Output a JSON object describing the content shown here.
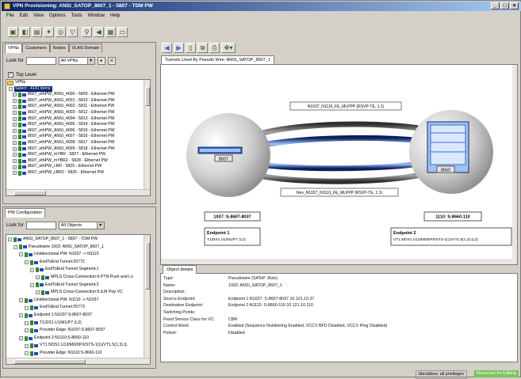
{
  "window": {
    "title": "VPN Provisioning: ANSI_SATOP_8607_1 - 5807 - TDM PW"
  },
  "menu": [
    "File",
    "Edit",
    "View",
    "Options",
    "Tools",
    "Window",
    "Help"
  ],
  "left_top": {
    "tabs": [
      "VPNs",
      "Customers",
      "Nodes",
      "VLAN Domain"
    ],
    "look_for_label": "Look for",
    "look_for_value": "",
    "filter_value": "All VPNs",
    "top_level_label": "Top Level",
    "tree_root": "VPNs",
    "selected_item": "Select - 4141 items:",
    "items": [
      "8607_ethPW_ANSI_4000 - 5809 - Ethernet PW",
      "8607_ethPW_ANSI_4001 - 5810 - Ethernet PW",
      "8607_ethPW_ANSI_4002 - 5811 - Ethernet PW",
      "8607_ethPW_ANSI_4003 - 5812 - Ethernet PW",
      "8607_ethPW_ANSI_4004 - 5813 - Ethernet PW",
      "8607_ethPW_ANSI_4005 - 5814 - Ethernet PW",
      "8607_ethPW_ANSI_4006 - 5815 - Ethernet PW",
      "8607_ethPW_ANSI_4007 - 5816 - Ethernet PW",
      "8607_ethPW_ANSI_4008 - 5817 - Ethernet PW",
      "8607_ethPW_ANSI_4009 - 5818 - Ethernet PW",
      "8607_ethPW_mYBR - 5827 - Ethernet PW",
      "8607_ethPW_mYBR2 - 5828 - Ethernet PW",
      "8607_ethPW_LBR - 5825 - Ethernet PW",
      "8607_ethPW_LBR2 - 5826 - Ethernet PW"
    ]
  },
  "left_bottom": {
    "tab": "PW Configuration",
    "look_for_label": "Look for",
    "filter_value": "All Objects",
    "tree": [
      {
        "indent": 0,
        "text": "ANSI_SATOP_8607_1 - 5807 - TDM PW"
      },
      {
        "indent": 1,
        "text": "Pseudowire 1002: ANSI_SATOP_8607_1"
      },
      {
        "indent": 2,
        "text": "Unidirectional PW: N1037 -> N1110"
      },
      {
        "indent": 3,
        "text": "EndToEnd Tunnel:25772"
      },
      {
        "indent": 4,
        "text": "EndToEnd Tunnel Segment:1"
      },
      {
        "indent": 5,
        "text": "MPLS Cross-Connection:6.PTN Push and Lo"
      },
      {
        "indent": 4,
        "text": "EndToEnd Tunnel Segment:2"
      },
      {
        "indent": 5,
        "text": "MPLS Cross-Connection:6.ILM Pop VC"
      },
      {
        "indent": 2,
        "text": "Unidirectional PW: N1110 -> N1037"
      },
      {
        "indent": 3,
        "text": "EndToEnd Tunnel:25773"
      },
      {
        "indent": 2,
        "text": "Endpoint 1:N1037:S-8607-8037"
      },
      {
        "indent": 3,
        "text": "T1/DS1 U1/M1/P7 (L2)"
      },
      {
        "indent": 3,
        "text": "Provider Edge: N1037:S-8607-8037"
      },
      {
        "indent": 2,
        "text": "Endpoint 2:N1110:S-8660-110"
      },
      {
        "indent": 3,
        "text": "VT1.5/DS1 U13/M0/DP0/STS-1(1)/VT1.5(1,3) (L"
      },
      {
        "indent": 3,
        "text": "Provider Edge: N1110:S-8660-110"
      }
    ]
  },
  "right": {
    "tab": "Tunnels Used By Pseudo Wire: ANSI_SATOP_8607_1",
    "tunnel_top_label": "N1037_N1110_FE_MLPPP (RSVP-TE, 1:1)",
    "tunnel_bottom_label": "Rev_N1037_N1110_FE_MLPPP (RSVP-TE, 1:1)",
    "node_left_badge": "8607",
    "node_right_badge": "8660",
    "node_left_label": "1037: S-8607-8037",
    "node_right_label": "1110: S-8660-110",
    "endpoint1_title": "Endpoint 1",
    "endpoint1_value": "T1/DS1 U1/M1/P7 (L2)",
    "endpoint2_title": "Endpoint 2",
    "endpoint2_value": "VT1.5/DS1 U13/M0/DP0/STS-1(1)/VT1.5(1,3) (L2)"
  },
  "details": {
    "tab": "Object details",
    "rows": [
      {
        "k": "Type:",
        "v": "Pseudowire (SAToP ,Rstx)"
      },
      {
        "k": "Name:",
        "v": "1002: ANSI_SATOP_8607_1"
      },
      {
        "k": "Description:",
        "v": ""
      },
      {
        "k": "Source Endpoint:",
        "v": "Endpoint 1:N1037: S-8607-8037  10.121.10.37"
      },
      {
        "k": "Destination Endpoint:",
        "v": "Endpoint 2:N1110: S-8660-110  10.121.10.110"
      },
      {
        "k": "Switching Points:",
        "v": ""
      },
      {
        "k": "Fixed Service Class for VC:",
        "v": "CBR"
      },
      {
        "k": "Control Word:",
        "v": "Enabled (Sequence Numbering Enabled, VCCV BFD Disabled, VCCV Ping Disabled)"
      },
      {
        "k": "Policer:",
        "v": "Disabled"
      }
    ]
  },
  "status": {
    "privileges": "bbnsbbns: all privileges",
    "mode": "Reserved for Editing"
  },
  "colors": {
    "accent": "#0a246a",
    "status_green": "#7cc35b"
  }
}
